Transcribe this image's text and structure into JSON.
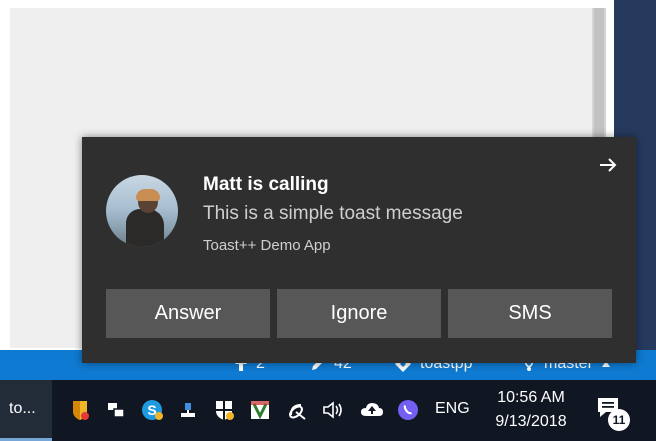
{
  "toast": {
    "title": "Matt is calling",
    "message": "This is a simple toast message",
    "attribution": "Toast++ Demo App",
    "buttons": [
      "Answer",
      "Ignore",
      "SMS"
    ]
  },
  "statusbar": {
    "push_count": "2",
    "pencil_count": "42",
    "repo": "toastpp",
    "branch": "master"
  },
  "taskbar": {
    "app_label": "to...",
    "language": "ENG",
    "time": "10:56 AM",
    "date": "9/13/2018",
    "notification_count": "11",
    "tray_icons": [
      "shield-icon",
      "task-view-icon",
      "skype-icon",
      "network-icon",
      "security-icon",
      "video-game-icon",
      "satellite-icon",
      "volume-icon",
      "onedrive-icon",
      "viber-icon"
    ]
  },
  "colors": {
    "toast_bg": "#2f2f2f",
    "button_bg": "#575757",
    "statusbar": "#0e7ad1",
    "taskbar": "#101723"
  }
}
